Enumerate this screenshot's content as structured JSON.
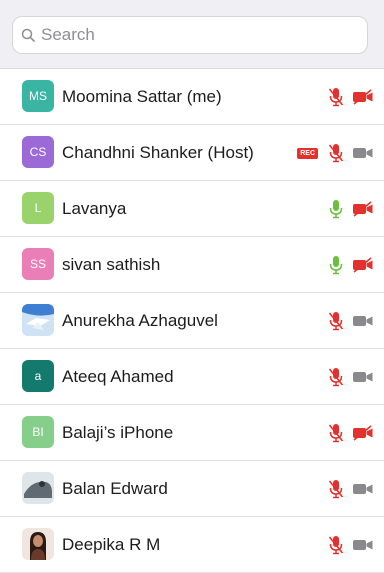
{
  "search": {
    "placeholder": "Search"
  },
  "colors": {
    "muted_red": "#e5312d",
    "mic_green": "#6abf3c",
    "cam_gray": "#8a8a8e"
  },
  "participants": [
    {
      "initials": "MS",
      "name": "Moomina Sattar (me)",
      "avatar_color": "#3ab5a4",
      "avatar_type": "initials",
      "rec": "",
      "mic": "muted",
      "cam": "off"
    },
    {
      "initials": "CS",
      "name": "Chandhni Shanker (Host)",
      "avatar_color": "#9b6ad6",
      "avatar_type": "initials",
      "rec": "REC",
      "mic": "muted",
      "cam": "on"
    },
    {
      "initials": "L",
      "name": "Lavanya",
      "avatar_color": "#9ad36b",
      "avatar_type": "initials",
      "rec": "",
      "mic": "active",
      "cam": "off"
    },
    {
      "initials": "SS",
      "name": "sivan sathish",
      "avatar_color": "#ea7fb7",
      "avatar_type": "initials",
      "rec": "",
      "mic": "active",
      "cam": "off"
    },
    {
      "initials": "",
      "name": "Anurekha Azhaguvel",
      "avatar_color": "#3f7fd1",
      "avatar_type": "photo",
      "rec": "",
      "mic": "muted",
      "cam": "on"
    },
    {
      "initials": "a",
      "name": "Ateeq Ahamed",
      "avatar_color": "#157a6e",
      "avatar_type": "initials",
      "rec": "",
      "mic": "muted",
      "cam": "on"
    },
    {
      "initials": "BI",
      "name": "Balaji’s iPhone",
      "avatar_color": "#86cf8a",
      "avatar_type": "initials",
      "rec": "",
      "mic": "muted",
      "cam": "off"
    },
    {
      "initials": "",
      "name": "Balan Edward",
      "avatar_color": "#5f6a72",
      "avatar_type": "photo",
      "rec": "",
      "mic": "muted",
      "cam": "on"
    },
    {
      "initials": "",
      "name": "Deepika R M",
      "avatar_color": "#6b3a2a",
      "avatar_type": "photo",
      "rec": "",
      "mic": "muted",
      "cam": "on"
    }
  ]
}
